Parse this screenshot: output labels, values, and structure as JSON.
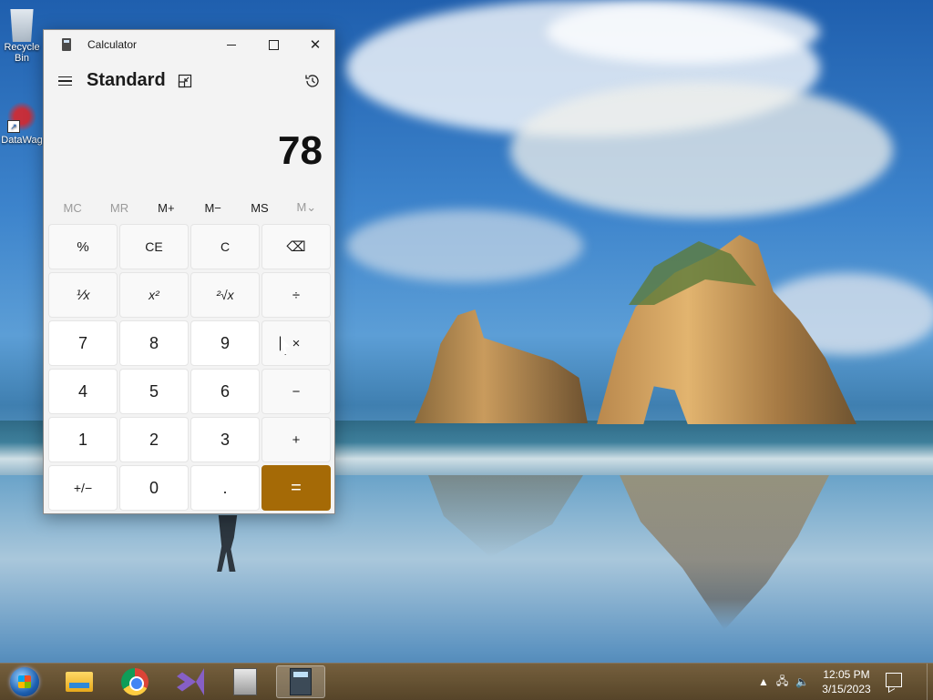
{
  "desktop": {
    "icons": [
      {
        "label": "Recycle Bin"
      },
      {
        "label": "DataWag"
      }
    ]
  },
  "calculator": {
    "window_title": "Calculator",
    "mode": "Standard",
    "display_value": "78",
    "memory_buttons": [
      "MC",
      "MR",
      "M+",
      "M−",
      "MS",
      "M⌄"
    ],
    "keys": [
      [
        "%",
        "CE",
        "C",
        "⌫"
      ],
      [
        "⅟x",
        "x²",
        "²√x",
        "÷"
      ],
      [
        "7",
        "8",
        "9",
        "×"
      ],
      [
        "4",
        "5",
        "6",
        "−"
      ],
      [
        "1",
        "2",
        "3",
        "+"
      ],
      [
        "+/−",
        "0",
        ".",
        "="
      ]
    ],
    "accent_color": "#a56a06"
  },
  "taskbar": {
    "items": [
      "start-button",
      "file-explorer",
      "google-chrome",
      "visual-studio",
      "document-app",
      "calculator"
    ],
    "active_item": "calculator",
    "clock_time": "12:05 PM",
    "clock_date": "3/15/2023"
  }
}
